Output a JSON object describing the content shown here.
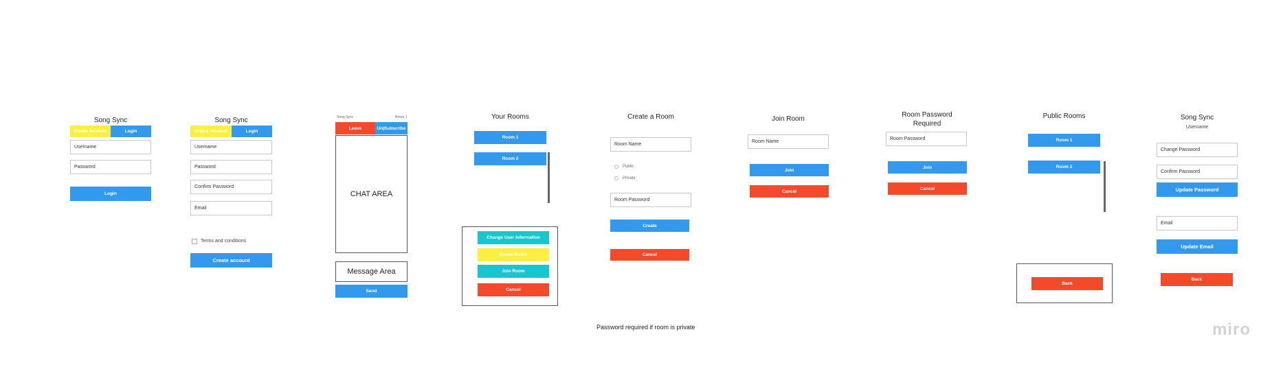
{
  "login": {
    "title": "Song Sync",
    "tab_create": "Create Account",
    "tab_login": "Login",
    "username": "Username",
    "password": "Password",
    "login_button": "Login"
  },
  "signup": {
    "title": "Song Sync",
    "tab_create": "Create Account",
    "tab_login": "Login",
    "username": "Username",
    "password": "Password",
    "confirm_password": "Confirm Password",
    "email": "Email",
    "terms": "Terms and conditions",
    "create_button": "Create account"
  },
  "chat": {
    "app_name": "Song Sync",
    "room": "Room 1",
    "leave": "Leave",
    "unsubscribe": "Un|Subscribe",
    "chat_area": "CHAT AREA",
    "message_area": "Message Area",
    "send": "Send"
  },
  "your_rooms": {
    "title": "Your Rooms",
    "room1": "Room 1",
    "room2": "Room 2",
    "menu_change_info": "Change User Information",
    "menu_create_room": "Create Room",
    "menu_join_room": "Join Room",
    "menu_cancel": "Cancel"
  },
  "create_room": {
    "title": "Create a Room",
    "room_name": "Room Name",
    "public": "Public",
    "private": "Private",
    "room_password": "Room Password",
    "create": "Create",
    "cancel": "Cancel"
  },
  "join_room": {
    "title": "Join Room",
    "room_name": "Room Name",
    "join": "Join",
    "cancel": "Cancel"
  },
  "room_password": {
    "title_line1": "Room Password",
    "title_line2": "Required",
    "room_password": "Room Password",
    "join": "Join",
    "cancel": "Cancel"
  },
  "public_rooms": {
    "title": "Public Rooms",
    "room1": "Room 1",
    "room2": "Room 2",
    "back": "Back"
  },
  "settings": {
    "title": "Song Sync",
    "subtitle": "Username",
    "change_password": "Change Password",
    "confirm_password": "Confirm Password",
    "update_password": "Update Password",
    "email": "Email",
    "update_email": "Update Email",
    "back": "Back"
  },
  "note": "Password required if room is private",
  "logo": "miro",
  "colors": {
    "blue": "#3399ec",
    "red": "#f24a2a",
    "yellow": "#fbf042",
    "teal": "#17c7cf"
  }
}
